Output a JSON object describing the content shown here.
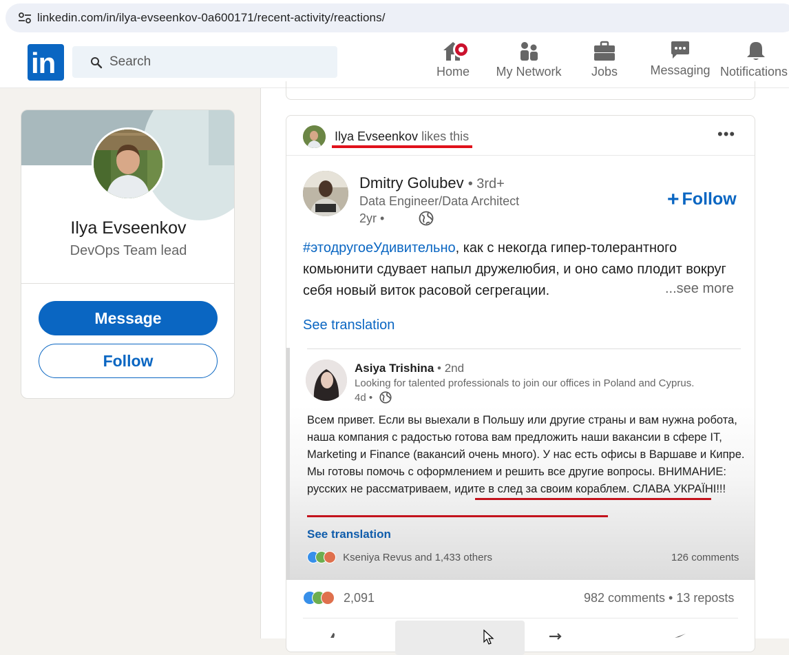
{
  "browser": {
    "url": "linkedin.com/in/ilya-evseenkov-0a600171/recent-activity/reactions/"
  },
  "nav": {
    "search_placeholder": "Search",
    "items": [
      {
        "label": "Home",
        "icon": "home-icon"
      },
      {
        "label": "My Network",
        "icon": "people-icon"
      },
      {
        "label": "Jobs",
        "icon": "briefcase-icon"
      },
      {
        "label": "Messaging",
        "icon": "chat-icon"
      },
      {
        "label": "Notifications",
        "icon": "bell-icon"
      }
    ]
  },
  "profile": {
    "name": "Ilya Evseenkov",
    "title": "DevOps Team lead",
    "message_label": "Message",
    "follow_label": "Follow"
  },
  "post": {
    "liker_name": "Ilya Evseenkov",
    "liker_action": "likes this",
    "author_name": "Dmitry Golubev",
    "author_degree": "• 3rd+",
    "author_headline": "Data Engineer/Data Architect",
    "author_time": "2yr •",
    "follow_label": "Follow",
    "hashtag": "#этодругоеУдивительно",
    "text": ", как с некогда гипер-толерантного комьюнити сдувает напыл дружелюбия, и оно само плодит вокруг себя новый виток расовой сегрегации.",
    "see_more": "...see more",
    "see_translation": "See translation",
    "reaction_count": "2,091",
    "comments_reposts": "982 comments • 13 reposts"
  },
  "embedded": {
    "name": "Asiya Trishina",
    "degree": "• 2nd",
    "headline": "Looking for talented professionals to join our offices in Poland and Cyprus.",
    "time": "4d •",
    "text": "Всем привет. Если вы выехали в Польшу или другие страны и вам нужна робота, наша компания с радостью готова вам предложить наши вакансии в сфере IT, Marketing и Finance (вакансий очень много). У нас есть офисы в Варшаве и Кипре. Мы готовы помочь с оформлением и решить все другие вопросы. ВНИМАНИЕ: русских не рассматриваем, идите в след за своим кораблем. СЛАВА УКРАЇНІ!!!",
    "see_translation": "See translation",
    "reactions": "Kseniya Revus and 1,433 others",
    "comments": "126 comments"
  },
  "colors": {
    "brand": "#0a66c2",
    "highlight_underline": "#e0111b",
    "notification": "#cb112d"
  }
}
